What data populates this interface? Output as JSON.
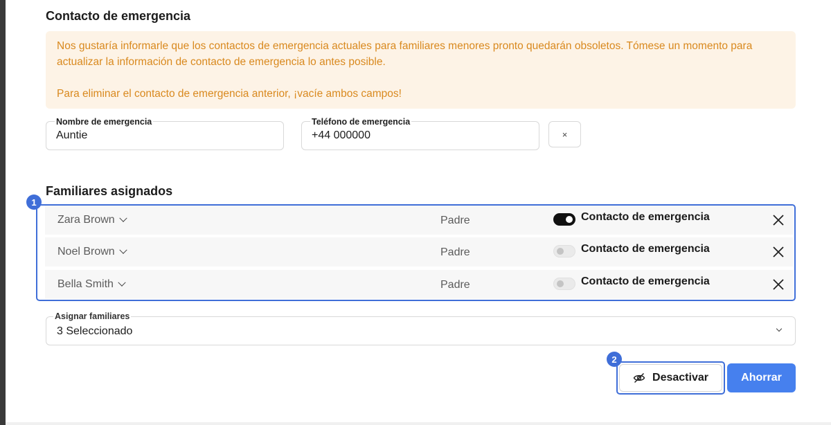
{
  "emergency_section": {
    "title": "Contacto de emergencia",
    "alert_line1": "Nos gustaría informarle que los contactos de emergencia actuales para familiares menores pronto quedarán obsoletos. Tómese un momento para actualizar la información de contacto de emergencia lo antes posible.",
    "alert_line2": "Para eliminar el contacto de emergencia anterior, ¡vacíe ambos campos!",
    "name_label": "Nombre de emergencia",
    "name_value": "Auntie",
    "phone_label": "Teléfono de emergencia",
    "phone_value": "+44 000000",
    "clear_label": "×"
  },
  "assigned_section": {
    "title": "Familiares asignados",
    "badge": "1",
    "members": [
      {
        "name": "Zara Brown",
        "role": "Padre",
        "toggle_label": "Contacto de emergencia",
        "emergency_contact": true
      },
      {
        "name": "Noel Brown",
        "role": "Padre",
        "toggle_label": "Contacto de emergencia",
        "emergency_contact": false
      },
      {
        "name": "Bella Smith",
        "role": "Padre",
        "toggle_label": "Contacto de emergencia",
        "emergency_contact": false
      }
    ]
  },
  "assign_select": {
    "label": "Asignar familiares",
    "value": "3 Seleccionado"
  },
  "actions": {
    "badge": "2",
    "deactivate_label": "Desactivar",
    "save_label": "Ahorrar"
  },
  "colors": {
    "accent": "#3f6ed8",
    "primary_button": "#4680ee",
    "alert_bg": "#fdf3e6",
    "alert_text": "#d9891e"
  },
  "icons": {
    "deactivate": "eye-off-icon",
    "remove": "close-icon",
    "expand": "chevron-down-icon"
  }
}
